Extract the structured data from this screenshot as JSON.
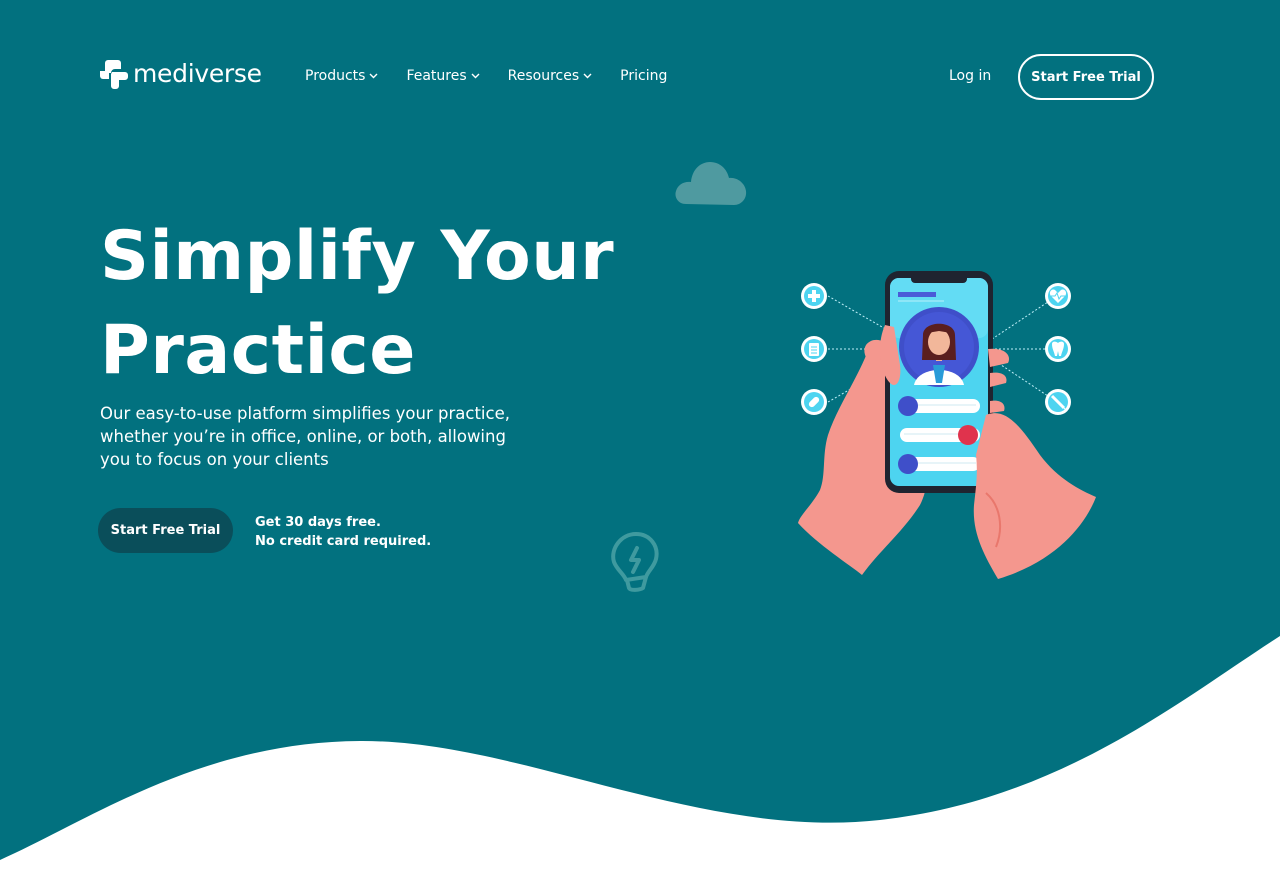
{
  "brand": {
    "name": "mediverse"
  },
  "nav": {
    "items": [
      {
        "label": "Products",
        "has_dropdown": true
      },
      {
        "label": "Features",
        "has_dropdown": true
      },
      {
        "label": "Resources",
        "has_dropdown": true
      },
      {
        "label": "Pricing",
        "has_dropdown": false
      }
    ],
    "login_label": "Log in",
    "cta_label": "Start Free Trial"
  },
  "hero": {
    "headline_line1": "Simplify Your",
    "headline_line2": "Practice",
    "subtext": "Our easy-to-use platform simplifies your practice, whether you’re in office, online, or both, allowing you to focus on your clients",
    "cta_label": "Start Free Trial",
    "note_line1": "Get 30 days free.",
    "note_line2": "No credit card required."
  },
  "icons": {
    "left": [
      "plus-icon",
      "clipboard-icon",
      "pills-icon"
    ],
    "right": [
      "heart-pulse-icon",
      "tooth-icon",
      "syringe-icon"
    ],
    "decorative": [
      "cloud-icon",
      "lightbulb-icon"
    ]
  },
  "colors": {
    "background": "#02717f",
    "cta_dark": "#0a4e5a",
    "text": "#ffffff",
    "accent_cyan": "#4dd4f0",
    "skin": "#f4978e"
  }
}
